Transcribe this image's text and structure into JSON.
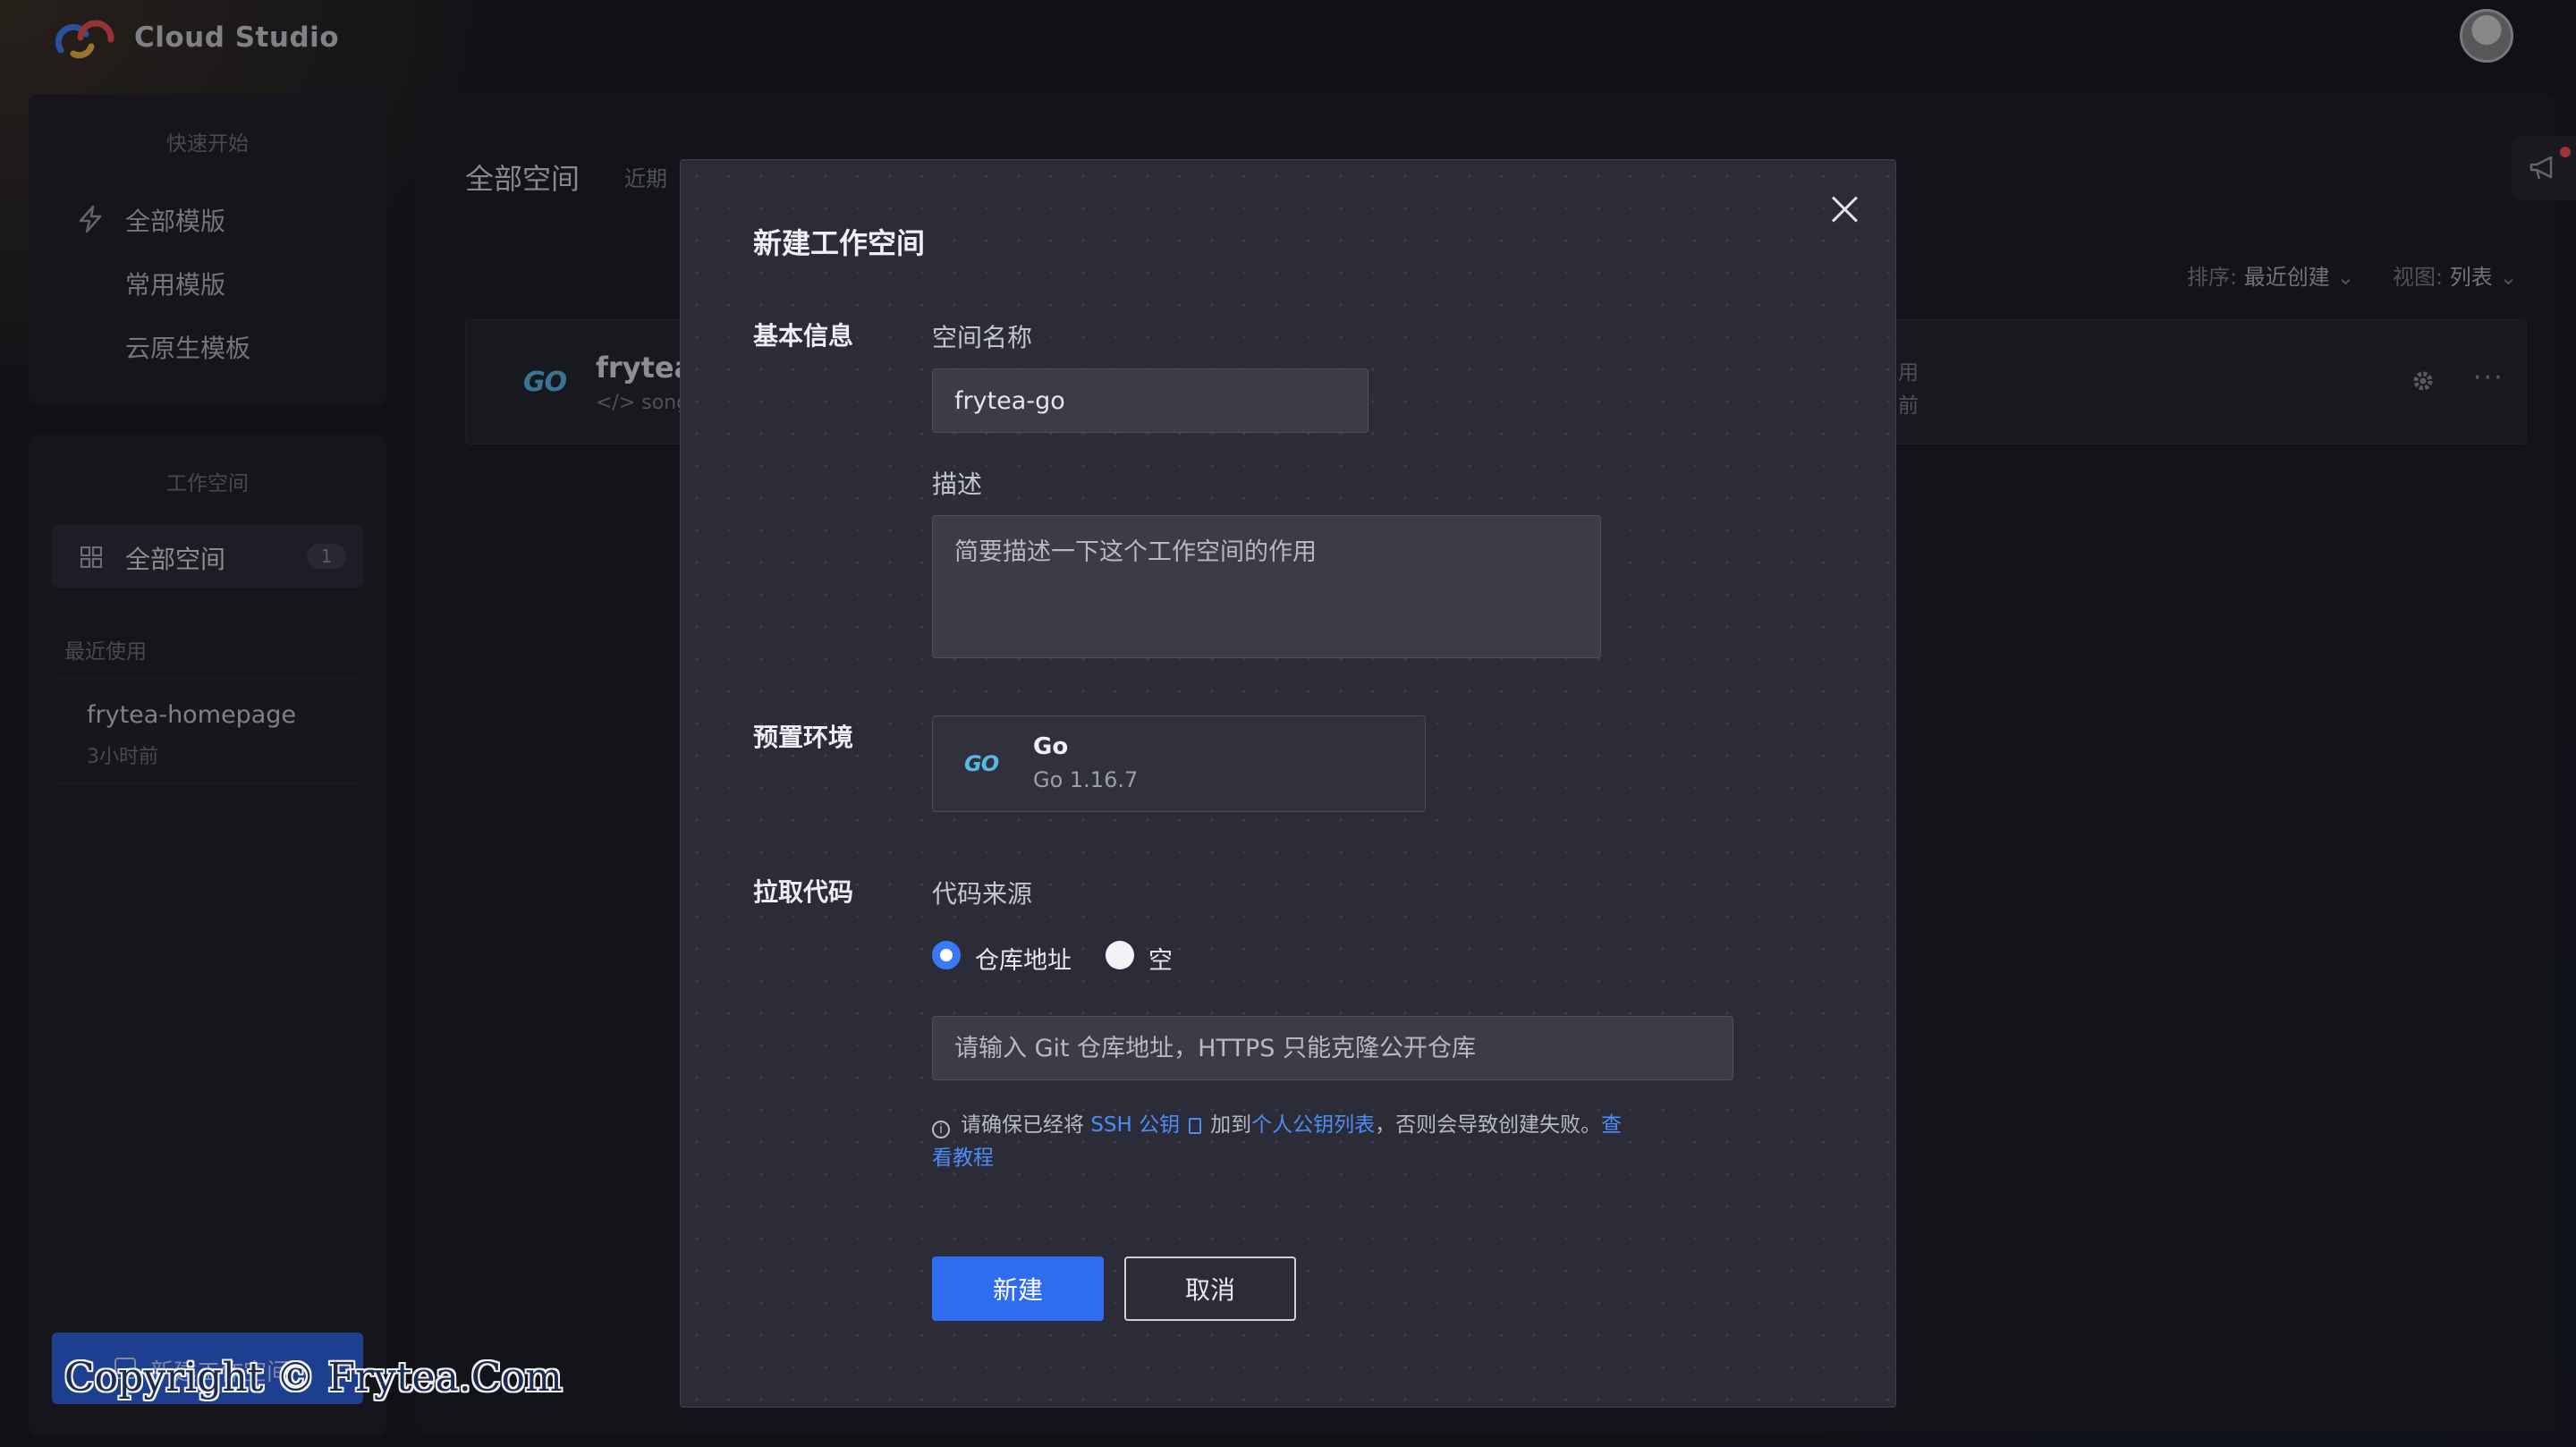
{
  "app": {
    "brand": "Cloud Studio"
  },
  "sidebar": {
    "quick_start": {
      "title": "快速开始",
      "items": [
        {
          "label": "全部模版",
          "icon": "lightning-icon"
        },
        {
          "label": "常用模版"
        },
        {
          "label": "云原生模板"
        }
      ]
    },
    "workspace": {
      "title": "工作空间",
      "all_label": "全部空间",
      "all_count": "1",
      "recent_title": "最近使用",
      "recent": [
        {
          "name": "frytea-homepage",
          "time": "3小时前"
        }
      ],
      "new_button": "新建工作空间"
    }
  },
  "main": {
    "title": "全部空间",
    "tab_partial": "近期",
    "sort_label": "排序:",
    "sort_value": "最近创建",
    "view_label": "视图:",
    "view_value": "列表",
    "card": {
      "go_badge": "GO",
      "name_partial": "frytea",
      "sub_partial": "songt",
      "status_partial": "用",
      "time_partial": "前"
    }
  },
  "modal": {
    "title": "新建工作空间",
    "basic_info": "基本信息",
    "name_label": "空间名称",
    "name_value": "frytea-go",
    "desc_label": "描述",
    "desc_placeholder": "简要描述一下这个工作空间的作用",
    "env_section": "预置环境",
    "env": {
      "name": "Go",
      "version": "Go 1.16.7",
      "logo": "GO"
    },
    "pull_section": "拉取代码",
    "source_label": "代码来源",
    "radio_repo": "仓库地址",
    "radio_empty": "空",
    "repo_placeholder": "请输入 Git 仓库地址，HTTPS 只能克隆公开仓库",
    "hint": {
      "pre": "请确保已经将",
      "ssh": "SSH 公钥",
      "mid": "加到",
      "list": "个人公钥列表",
      "post": "，否则会导致创建失败。",
      "tutorial": "查看教程"
    },
    "create_button": "新建",
    "cancel_button": "取消"
  },
  "watermark": "Copyright © Frytea.Com",
  "colors": {
    "accent": "#2f6df0",
    "link": "#4c8cf5",
    "go": "#58b8e4"
  }
}
